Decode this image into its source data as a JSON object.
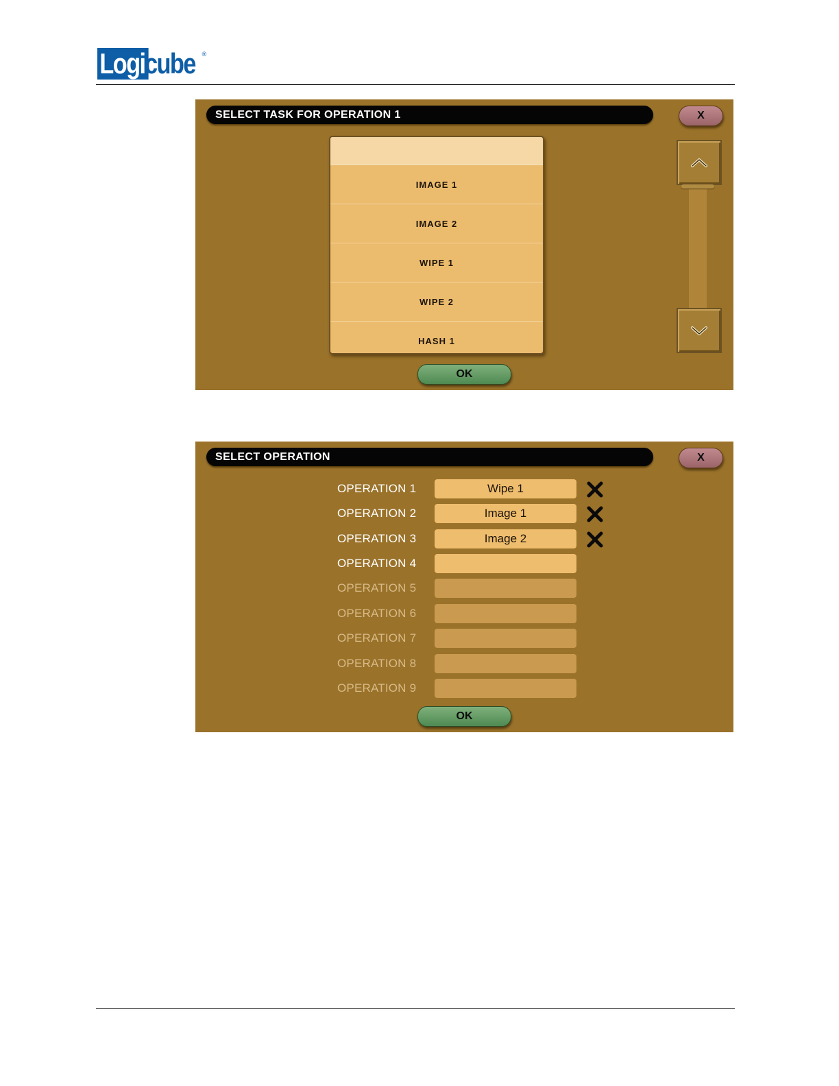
{
  "logo": {
    "box_text": "Logi",
    "text": "cube",
    "reg": "®"
  },
  "dialog1": {
    "title": "SELECT TASK FOR OPERATION 1",
    "close_label": "X",
    "items": [
      {
        "label": ""
      },
      {
        "label": "IMAGE 1"
      },
      {
        "label": "IMAGE 2"
      },
      {
        "label": "WIPE 1"
      },
      {
        "label": "WIPE 2"
      },
      {
        "label": "HASH 1"
      }
    ],
    "ok_label": "OK",
    "icons": {
      "up": "chevron-up-icon",
      "down": "chevron-down-icon"
    }
  },
  "dialog2": {
    "title": "SELECT OPERATION",
    "close_label": "X",
    "operations": [
      {
        "label": "OPERATION 1",
        "value": "Wipe 1"
      },
      {
        "label": "OPERATION 2",
        "value": "Image 1"
      },
      {
        "label": "OPERATION 3",
        "value": "Image 2"
      },
      {
        "label": "OPERATION 4",
        "value": ""
      },
      {
        "label": "OPERATION 5",
        "value": ""
      },
      {
        "label": "OPERATION 6",
        "value": ""
      },
      {
        "label": "OPERATION 7",
        "value": ""
      },
      {
        "label": "OPERATION 8",
        "value": ""
      },
      {
        "label": "OPERATION 9",
        "value": ""
      }
    ],
    "ok_label": "OK",
    "remove_icon": "x-remove-icon"
  },
  "colors": {
    "panel": "#9a722a",
    "field": "#efbd6e",
    "ok": "#5e995e",
    "close": "#b07c80",
    "brand": "#0d5ea6"
  }
}
